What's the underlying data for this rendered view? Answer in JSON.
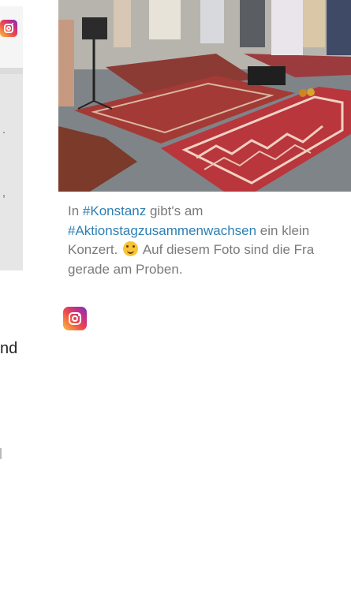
{
  "left_card": {
    "fragments": [
      ".",
      ",",
      "-"
    ]
  },
  "left_text": "nd",
  "photo": {
    "icon": "photo-rugs-concert"
  },
  "caption": {
    "prefix": "In ",
    "tag1": "#Konstanz",
    "mid1": " gibt's am",
    "tag2": "#Aktionstagzusammenwachsen",
    "mid2": " ein klein",
    "mid3": "Konzert. ",
    "emoji": "smiling-face-icon",
    "mid4": " Auf diesem Foto sind die Fra",
    "end": "gerade am Proben."
  },
  "colors": {
    "hashtag": "#2e7fb3",
    "caption_text": "#7a7a7a"
  },
  "icons": {
    "instagram": "instagram-icon"
  }
}
